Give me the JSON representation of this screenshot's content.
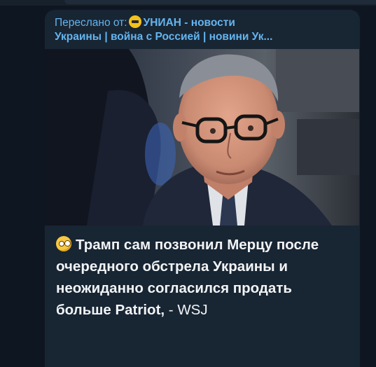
{
  "forward": {
    "prefix": "Переслано от:",
    "source_line1": "УНИАН - новости",
    "source_line2": "Украины | война с Россией | новини Ук..."
  },
  "photo": {
    "alt": "Фото"
  },
  "post": {
    "emoji": "🧐",
    "headline": "Трамп сам позвонил Мерцу после очередного обстрела Украины и неожиданно согласился продать больше Patriot,",
    "attribution": " - WSJ"
  }
}
